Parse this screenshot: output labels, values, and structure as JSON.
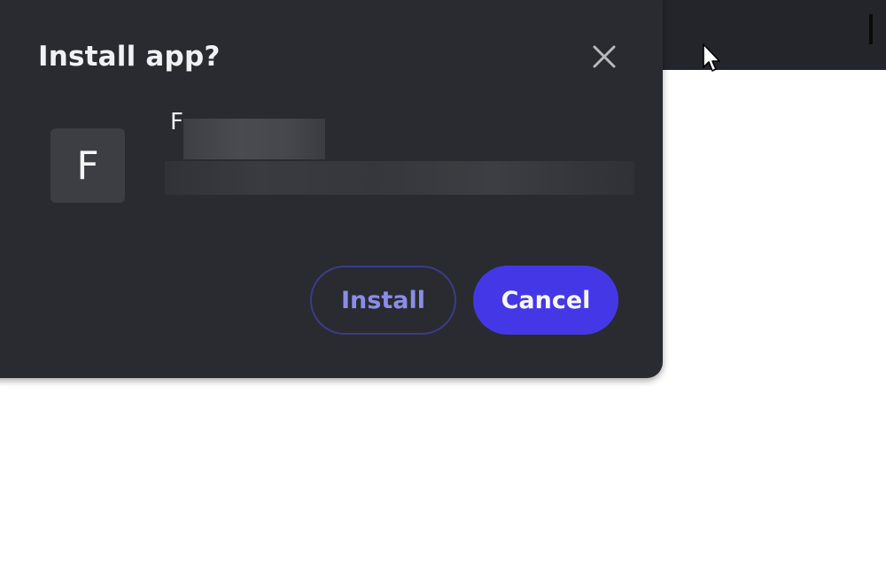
{
  "dialog": {
    "title": "Install app?",
    "close_icon": "close-icon",
    "app": {
      "icon_letter": "F",
      "name_visible": "F"
    },
    "buttons": {
      "install_label": "Install",
      "cancel_label": "Cancel"
    }
  },
  "colors": {
    "dialog_bg": "#2a2b30",
    "topbar_bg": "#23252b",
    "accent": "#4438e6",
    "install_text": "#8a8de8"
  },
  "cursor": "arrow-cursor-icon"
}
